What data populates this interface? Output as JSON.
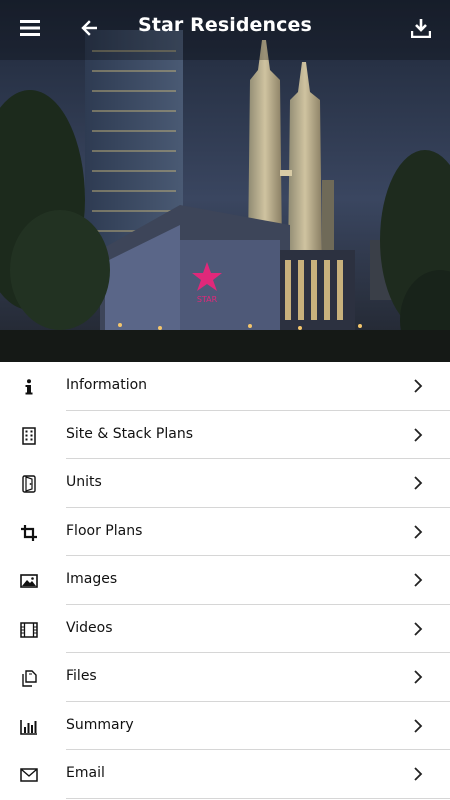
{
  "header": {
    "title": "Star Residences",
    "menu_icon": "hamburger-icon",
    "back_icon": "arrow-left-icon",
    "download_icon": "download-icon"
  },
  "hero": {
    "sign_text": "STAR"
  },
  "menu": {
    "items": [
      {
        "label": "Information",
        "icon": "info-icon"
      },
      {
        "label": "Site & Stack Plans",
        "icon": "building-icon"
      },
      {
        "label": "Units",
        "icon": "door-icon"
      },
      {
        "label": "Floor Plans",
        "icon": "crop-icon"
      },
      {
        "label": "Images",
        "icon": "image-icon"
      },
      {
        "label": "Videos",
        "icon": "film-icon"
      },
      {
        "label": "Files",
        "icon": "files-icon"
      },
      {
        "label": "Summary",
        "icon": "bar-chart-icon"
      },
      {
        "label": "Email",
        "icon": "mail-icon"
      }
    ]
  },
  "colors": {
    "header_text": "#ffffff",
    "text": "#111111",
    "divider": "#d6d6d6",
    "sign_pink": "#e0287a"
  }
}
